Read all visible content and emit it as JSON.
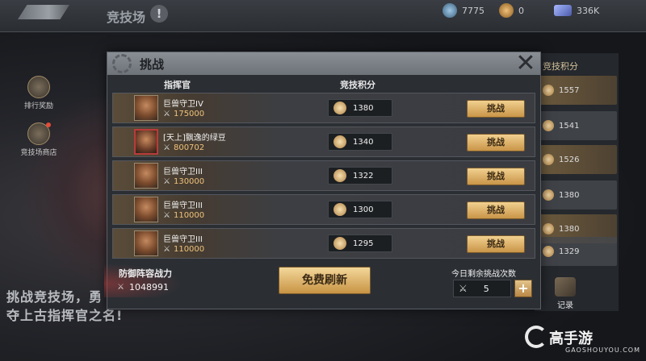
{
  "topbar": {
    "title": "竞技场",
    "info_icon": "!",
    "resources": [
      {
        "icon": "gem-icon",
        "value": "7775"
      },
      {
        "icon": "coin-icon",
        "value": "0"
      },
      {
        "icon": "ore-icon",
        "value": "336K"
      }
    ]
  },
  "sidebar": {
    "items": [
      {
        "label": "排行奖励",
        "icon": "ranking-reward-icon"
      },
      {
        "label": "竞技场商店",
        "icon": "shop-icon"
      }
    ]
  },
  "background": {
    "line1": "挑战竞技场，勇",
    "line2": "夺上古指挥官之名!",
    "rank_column_header": "竞技积分",
    "rank_values": [
      "1557",
      "1541",
      "1526",
      "1380",
      "1380",
      "1329"
    ],
    "record_label": "记录"
  },
  "modal": {
    "title": "挑战",
    "close_icon": "✕",
    "col_commander": "指挥官",
    "col_score": "竞技积分",
    "rows": [
      {
        "name": "巨兽守卫IV",
        "power": "175000",
        "score": "1380",
        "button": "挑战"
      },
      {
        "name": "[天上]飘逸的绿豆",
        "power": "800702",
        "score": "1340",
        "button": "挑战"
      },
      {
        "name": "巨兽守卫III",
        "power": "130000",
        "score": "1322",
        "button": "挑战"
      },
      {
        "name": "巨兽守卫III",
        "power": "110000",
        "score": "1300",
        "button": "挑战"
      },
      {
        "name": "巨兽守卫III",
        "power": "110000",
        "score": "1295",
        "button": "挑战"
      }
    ],
    "defense_label": "防御阵容战力",
    "defense_value": "1048991",
    "refresh_button": "免费刷新",
    "remaining_label": "今日剩余挑战次数",
    "remaining_value": "5",
    "plus_label": "+"
  },
  "logo": {
    "name": "高手游",
    "sub": "GAOSHOUYOU.COM"
  }
}
